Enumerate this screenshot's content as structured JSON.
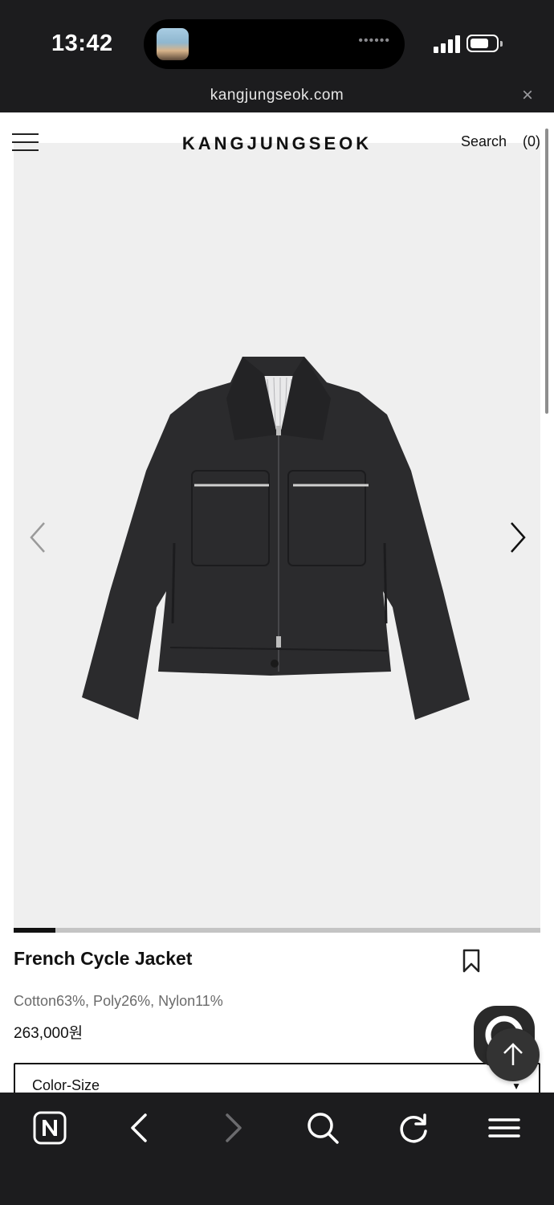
{
  "status_bar": {
    "time": "13:42",
    "island_dots": "••••••",
    "icons": [
      "music-thumbnail",
      "signal-icon",
      "battery-icon"
    ]
  },
  "browser": {
    "url": "kangjungseok.com",
    "close_glyph": "×"
  },
  "site": {
    "logo": "KANGJUNGSEOK",
    "search_label": "Search",
    "cart_label": "(0)"
  },
  "product": {
    "title": "French Cycle Jacket",
    "composition": "Cotton63%, Poly26%, Nylon11%",
    "price": "263,000원",
    "image_description_icon": "jacket-icon",
    "gallery_progress": 0.08
  },
  "options": {
    "select_label": "Color-Size",
    "caret": "▼"
  },
  "toolbar": {
    "icons": [
      "naver-home-icon",
      "back-icon",
      "forward-icon",
      "search-icon",
      "reload-icon",
      "menu-icon"
    ]
  },
  "colors": {
    "system_bar": "#1c1c1e",
    "gallery_bg": "#efefef",
    "jacket": "#2b2b2d",
    "progress_track": "#c4c4c4",
    "progress_fill": "#111111"
  }
}
